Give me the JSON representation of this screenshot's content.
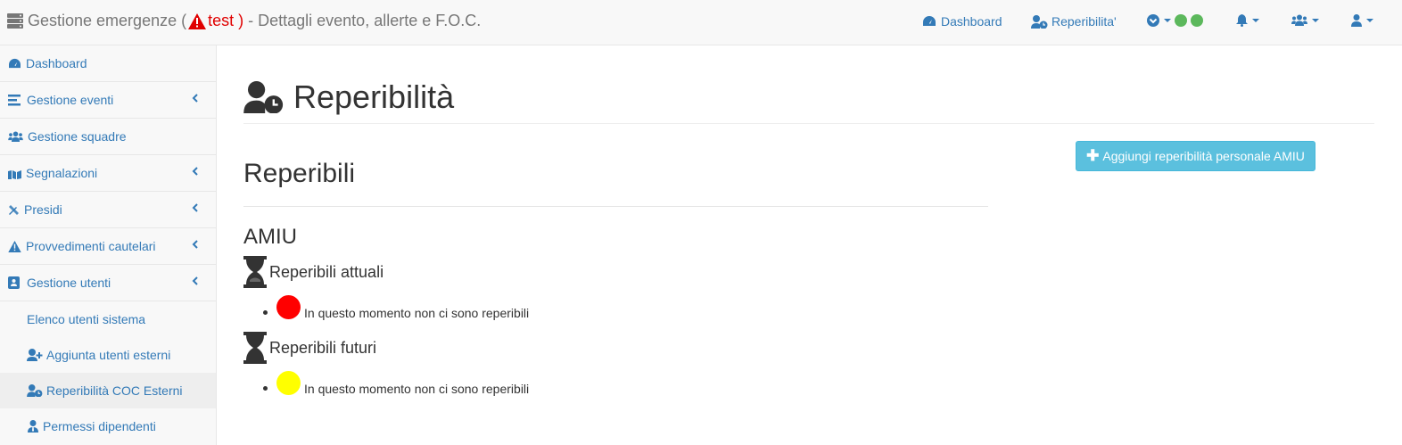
{
  "header": {
    "title_prefix": "Gestione emergenze (",
    "env": "test )",
    "title_suffix": "- Dettagli evento, allerte e F.O.C.",
    "nav": {
      "dashboard": "Dashboard",
      "reperibilita": "Reperibilita'"
    }
  },
  "sidebar": {
    "items": [
      {
        "label": "Dashboard"
      },
      {
        "label": "Gestione eventi"
      },
      {
        "label": "Gestione squadre"
      },
      {
        "label": "Segnalazioni"
      },
      {
        "label": "Presidi"
      },
      {
        "label": "Provvedimenti cautelari"
      },
      {
        "label": "Gestione utenti"
      }
    ],
    "subitems": [
      {
        "label": "Elenco utenti sistema"
      },
      {
        "label": "Aggiunta utenti esterni"
      },
      {
        "label": "Reperibilità COC Esterni"
      },
      {
        "label": "Permessi dipendenti"
      }
    ]
  },
  "main": {
    "page_title": "Reperibilità",
    "add_button": "Aggiungi reperibilità personale AMIU",
    "section_title": "Reperibili",
    "group": "AMIU",
    "attuali": {
      "title": "Reperibili attuali",
      "message": "In questo momento non ci sono reperibili",
      "status_color": "#ff0000"
    },
    "futuri": {
      "title": "Reperibili futuri",
      "message": "In questo momento non ci sono reperibili",
      "status_color": "#ffff00"
    }
  },
  "colors": {
    "accent": "#337ab7",
    "info_button": "#5bc0de",
    "status_green": "#5cb85c",
    "warning_red": "#e00000"
  }
}
